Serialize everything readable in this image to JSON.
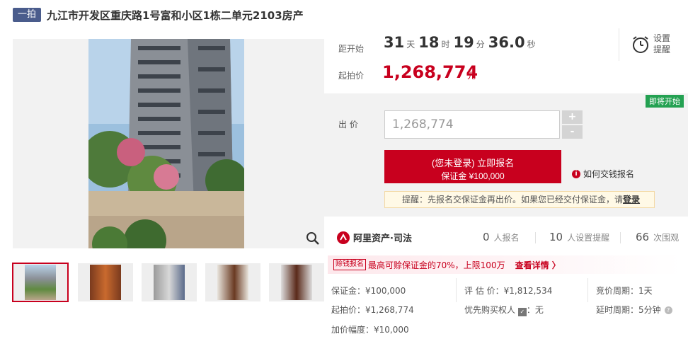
{
  "title": {
    "badge": "一拍",
    "text": "九江市开发区重庆路1号富和小区1栋二单元2103房产"
  },
  "countdown": {
    "label": "距开始",
    "days": "31",
    "days_unit": "天",
    "hours": "18",
    "hours_unit": "时",
    "minutes": "19",
    "minutes_unit": "分",
    "seconds": "36.0",
    "seconds_unit": "秒"
  },
  "start_price": {
    "label": "起拍价",
    "value": "1,268,774",
    "unit": "元"
  },
  "reminder": {
    "label": "设置提醒",
    "icon": "alarm-clock-icon"
  },
  "bid": {
    "status_tag": "即将开始",
    "label": "出 价",
    "input_value": "1,268,774",
    "plus": "+",
    "minus": "-",
    "signup_line1": "(您未登录) 立即报名",
    "signup_line2": "保证金 ¥100,000",
    "how_pay": "如何交钱报名",
    "notice_text": "提醒：先报名交保证金再出价。如果您已经交付保证金，请",
    "notice_link": "登录"
  },
  "stats": {
    "brand": "阿里资产·司法",
    "registered_count": "0",
    "registered_label": "人报名",
    "reminder_count": "10",
    "reminder_label": "人设置提醒",
    "views_count": "66",
    "views_label": "次围观"
  },
  "promo": {
    "tag": "赊钱报名",
    "text": "最高可赊保证金的70%，上限100万",
    "link": "查看详情 〉"
  },
  "details": {
    "deposit": "保证金：¥100,000",
    "appraisal": "评 估 价：¥1,812,534",
    "cycle": "竞价周期：1天",
    "start": "起拍价：¥1,268,774",
    "priority_label": "优先购买权人",
    "priority_value": "：无",
    "delay": "延时周期：5分钟",
    "increment": "加价幅度：¥10,000"
  },
  "colors": {
    "accent": "#c8001e",
    "badge": "#4a5c8c",
    "status_green": "#24a152"
  }
}
